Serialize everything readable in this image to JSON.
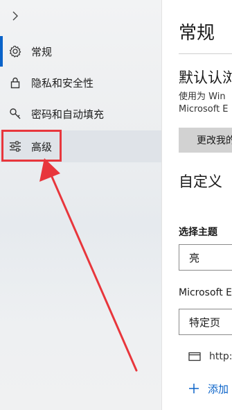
{
  "sidebar": {
    "items": [
      {
        "label": "常规",
        "icon": "gear-icon"
      },
      {
        "label": "隐私和安全性",
        "icon": "lock-icon"
      },
      {
        "label": "密码和自动填充",
        "icon": "key-icon"
      },
      {
        "label": "高级",
        "icon": "sliders-icon"
      }
    ]
  },
  "main": {
    "page_title": "常规",
    "default_browser": {
      "heading": "默认认浏览",
      "description_line1": "使用为 Win",
      "description_line2": "Microsoft E",
      "button_label": "更改我的"
    },
    "customize": {
      "heading": "自定义",
      "theme_label": "选择主题",
      "theme_value": "亮",
      "startup_label": "Microsoft E",
      "startup_value": "特定页",
      "url_text": "http:",
      "add_label": "添加"
    }
  },
  "colors": {
    "accent": "#0a63c9",
    "highlight": "#e8363c"
  }
}
